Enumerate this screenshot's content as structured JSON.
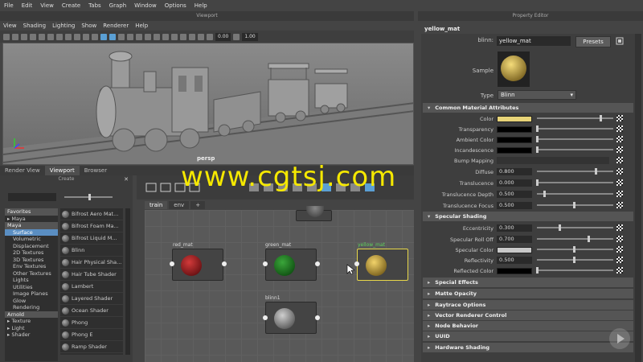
{
  "menubar": [
    "File",
    "Edit",
    "View",
    "Create",
    "Tabs",
    "Graph",
    "Window",
    "Options",
    "Help"
  ],
  "viewport": {
    "title": "Viewport",
    "menu": [
      "View",
      "Shading",
      "Lighting",
      "Show",
      "Renderer",
      "Help"
    ],
    "value1": "0.00",
    "value2": "1.00",
    "camera_label": "persp",
    "tabs": [
      "Render View",
      "Viewport",
      "Browser"
    ]
  },
  "watermark": "www.cgtsj.com",
  "create_panel": {
    "title": "Create",
    "close": "✕",
    "tree": [
      {
        "label": "Favorites",
        "kind": "hdr"
      },
      {
        "label": "Maya",
        "kind": "arrow"
      },
      {
        "label": "Maya",
        "kind": "hdr"
      },
      {
        "label": "Surface",
        "kind": "sel"
      },
      {
        "label": "Volumetric",
        "kind": "item"
      },
      {
        "label": "Displacement",
        "kind": "item"
      },
      {
        "label": "2D Textures",
        "kind": "item"
      },
      {
        "label": "3D Textures",
        "kind": "item"
      },
      {
        "label": "Env Textures",
        "kind": "item"
      },
      {
        "label": "Other Textures",
        "kind": "item"
      },
      {
        "label": "Lights",
        "kind": "item"
      },
      {
        "label": "Utilities",
        "kind": "item"
      },
      {
        "label": "Image Planes",
        "kind": "item"
      },
      {
        "label": "Glow",
        "kind": "item"
      },
      {
        "label": "Rendering",
        "kind": "item"
      },
      {
        "label": "Arnold",
        "kind": "hdr"
      },
      {
        "label": "Texture",
        "kind": "arrow"
      },
      {
        "label": "Light",
        "kind": "arrow"
      },
      {
        "label": "Shader",
        "kind": "arrow"
      }
    ],
    "shaders": [
      "Bifrost Aero Mat...",
      "Bifrost Foam Ma...",
      "Bifrost Liquid M...",
      "Blinn",
      "Hair Physical Sha...",
      "Hair Tube Shader",
      "Lambert",
      "Layered Shader",
      "Ocean Shader",
      "Phong",
      "Phong E",
      "Ramp Shader"
    ]
  },
  "hypershade": {
    "tabs": [
      "train",
      "env",
      "+"
    ],
    "nodes": [
      {
        "name": "red_mat",
        "color": "#8b0f14"
      },
      {
        "name": "green_mat",
        "color": "#0f5a14"
      },
      {
        "name": "yellow_mat",
        "color": "#b8952a"
      },
      {
        "name": "blinn1",
        "color": "#8a8a8a"
      }
    ]
  },
  "property_editor": {
    "title": "Property Editor",
    "tab": "yellow_mat",
    "node_type_label": "blinn:",
    "node_name": "yellow_mat",
    "presets_label": "Presets",
    "sample_label": "Sample",
    "type_label": "Type",
    "type_value": "Blinn",
    "common_section": "Common Material Attributes",
    "common": [
      {
        "label": "Color",
        "swatch": "#e8d478",
        "slider": 0.9
      },
      {
        "label": "Transparency",
        "swatch": "#000000",
        "slider": 0.0
      },
      {
        "label": "Ambient Color",
        "swatch": "#000000",
        "slider": 0.0
      },
      {
        "label": "Incandescence",
        "swatch": "#000000",
        "slider": 0.0
      }
    ],
    "bump_label": "Bump Mapping",
    "common_fields": [
      {
        "label": "Diffuse",
        "value": "0.800",
        "slider": 0.8
      },
      {
        "label": "Translucence",
        "value": "0.000",
        "slider": 0.0
      },
      {
        "label": "Translucence Depth",
        "value": "0.500",
        "slider": 0.05
      },
      {
        "label": "Translucence Focus",
        "value": "0.500",
        "slider": 0.5
      }
    ],
    "specular_section": "Specular Shading",
    "specular": [
      {
        "label": "Eccentricity",
        "value": "0.300",
        "slider": 0.3
      },
      {
        "label": "Specular Roll Off",
        "value": "0.700",
        "slider": 0.7
      },
      {
        "label": "Specular Color",
        "swatch": "#c8c8c8",
        "slider": 0.5
      },
      {
        "label": "Reflectivity",
        "value": "0.500",
        "slider": 0.5
      },
      {
        "label": "Reflected Color",
        "swatch": "#000000",
        "slider": 0.0
      }
    ],
    "collapsed_sections": [
      "Special Effects",
      "Matte Opacity",
      "Raytrace Options",
      "Vector Renderer Control",
      "Node Behavior",
      "UUID",
      "Hardware Shading"
    ]
  }
}
